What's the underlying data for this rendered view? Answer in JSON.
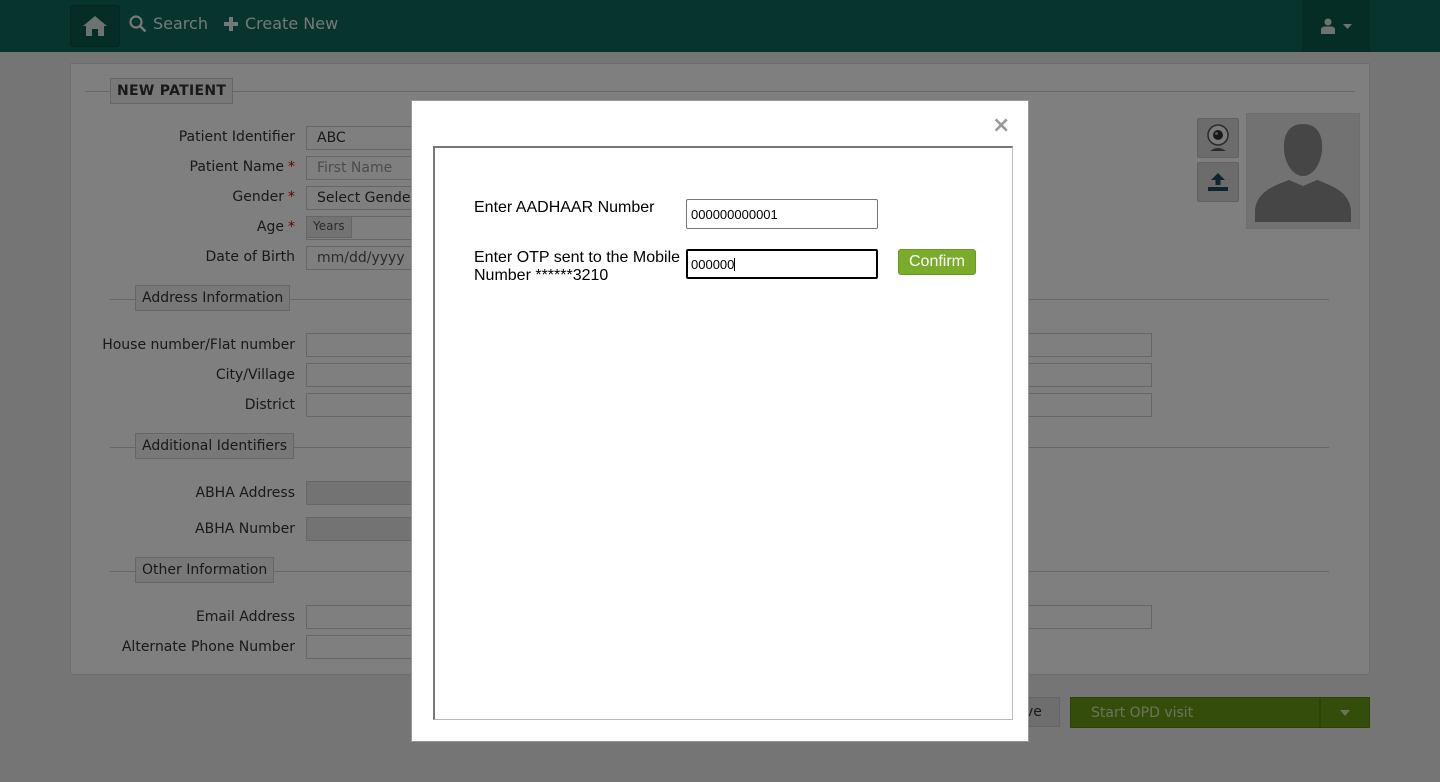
{
  "nav": {
    "search_label": "Search",
    "create_new_label": "Create New"
  },
  "form": {
    "section_title": "NEW PATIENT",
    "fields": {
      "patient_identifier": {
        "label": "Patient Identifier",
        "value": "ABC"
      },
      "patient_name": {
        "label": "Patient Name",
        "placeholder": "First Name"
      },
      "gender": {
        "label": "Gender",
        "value": "Select Gender"
      },
      "age": {
        "label": "Age",
        "unit": "Years"
      },
      "dob": {
        "label": "Date of Birth",
        "placeholder": "mm/dd/yyyy"
      }
    },
    "required_mark": "*",
    "address": {
      "title": "Address Information",
      "house_label": "House number/Flat number",
      "city_label": "City/Village",
      "district_label": "District"
    },
    "additional": {
      "title": "Additional Identifiers",
      "abha_address_label": "ABHA Address",
      "abha_number_label": "ABHA Number"
    },
    "other": {
      "title": "Other Information",
      "email_label": "Email Address",
      "alt_phone_label": "Alternate Phone Number"
    }
  },
  "actions": {
    "save_label_partial": "ve",
    "start_opd_label": "Start OPD visit"
  },
  "modal": {
    "close_symbol": "×",
    "aadhaar_label": "Enter AADHAAR Number",
    "aadhaar_value": "000000000001",
    "otp_label_line1": "Enter OTP sent to the Mobile",
    "otp_label_line2": "Number ******3210",
    "otp_value": "000000",
    "confirm_label": "Confirm"
  },
  "colors": {
    "navbar": "#0f6859",
    "confirm_button": "#7bab2b",
    "opd_button": "#6a9a14"
  }
}
